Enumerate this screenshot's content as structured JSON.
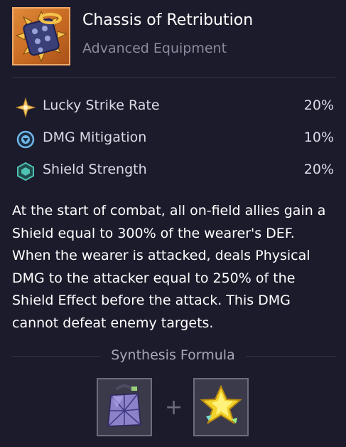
{
  "item": {
    "title": "Chassis of Retribution",
    "subtitle": "Advanced Equipment",
    "icon": "spiked-chassis-icon"
  },
  "stats": [
    {
      "label": "Lucky Strike Rate",
      "value": "20%",
      "icon": "lucky-star-icon"
    },
    {
      "label": "DMG Mitigation",
      "value": "10%",
      "icon": "mitigation-icon"
    },
    {
      "label": "Shield Strength",
      "value": "20%",
      "icon": "shield-hex-icon"
    }
  ],
  "description": "At the start of combat, all on-field allies gain a Shield equal to 300% of the wearer's DEF. When the wearer is attacked, deals Physical DMG to the attacker equal to 250% of the Shield Effect before the attack. This DMG cannot defeat enemy targets.",
  "synthesis": {
    "title": "Synthesis Formula",
    "operator": "+",
    "materials": [
      {
        "icon": "purple-backpack-icon"
      },
      {
        "icon": "yellow-star-icon"
      }
    ]
  },
  "colors": {
    "background": "#1c1b2b",
    "title": "#ffffff",
    "subtitle": "#8c8a9e",
    "stat_text": "#dcdbe6",
    "accent_orange": "#d9772e"
  }
}
